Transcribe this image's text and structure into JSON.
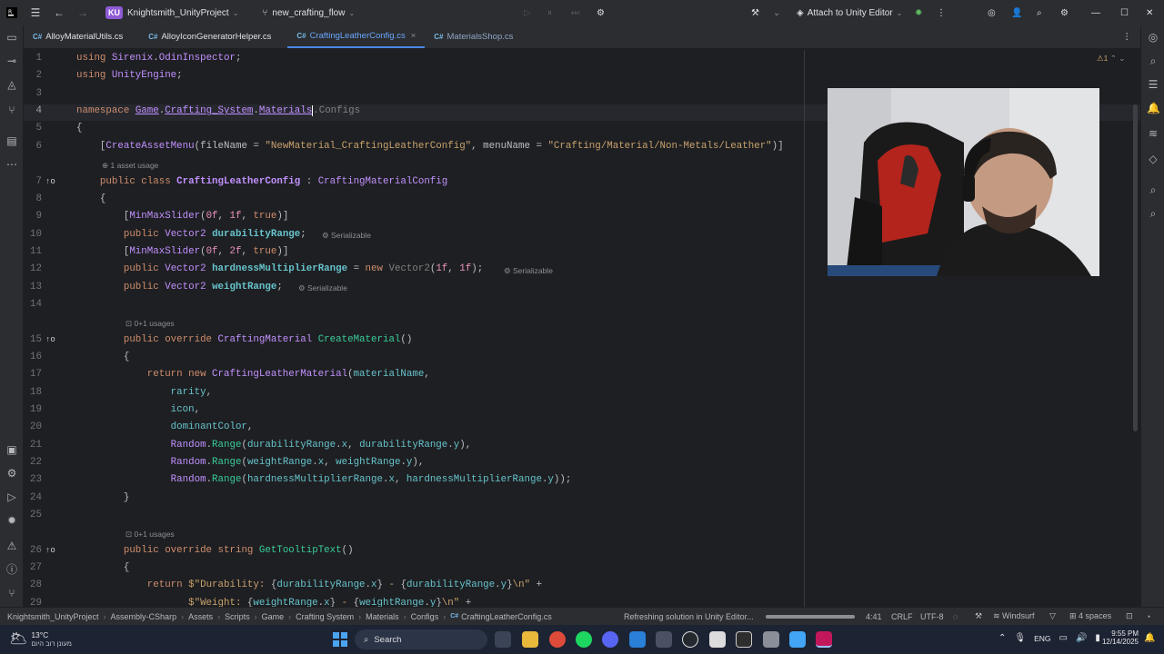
{
  "titlebar": {
    "project_badge": "KU",
    "project_name": "Knightsmith_UnityProject",
    "branch": "new_crafting_flow",
    "attach": "Attach to Unity Editor"
  },
  "tabs": [
    {
      "label": "AlloyMaterialUtils.cs"
    },
    {
      "label": "AlloyIconGeneratorHelper.cs"
    },
    {
      "label": "CraftingLeatherConfig.cs"
    },
    {
      "label": "MaterialsShop.cs"
    }
  ],
  "editor": {
    "inspection_count": "1",
    "hints": {
      "asset_usage": "1 asset usage",
      "usages_a": "0+1 usages",
      "usages_b": "0+1 usages",
      "serializable": "Serializable"
    },
    "line_numbers": [
      "1",
      "2",
      "3",
      "4",
      "5",
      "6",
      "7",
      "8",
      "9",
      "10",
      "11",
      "12",
      "13",
      "14",
      "15",
      "16",
      "17",
      "18",
      "19",
      "20",
      "21",
      "22",
      "23",
      "24",
      "25",
      "26",
      "27",
      "28",
      "29"
    ]
  },
  "statusbar": {
    "breadcrumb": [
      "Knightsmith_UnityProject",
      "Assembly-CSharp",
      "Assets",
      "Scripts",
      "Game",
      "Crafting System",
      "Materials",
      "Configs",
      "CraftingLeatherConfig.cs"
    ],
    "refresh_text": "Refreshing solution in Unity Editor...",
    "position": "4:41",
    "line_sep": "CRLF",
    "encoding": "UTF-8",
    "plugin": "Windsurf",
    "indent": "4 spaces"
  },
  "taskbar": {
    "temp": "13°C",
    "weather": "מעונן רוב היום",
    "search_placeholder": "Search",
    "lang": "ENG",
    "time": "9:55 PM",
    "date": "12/14/2025"
  },
  "colors": {
    "accent": "#4a88e8",
    "editor_bg": "#1e1f22",
    "panel_bg": "#2b2d30"
  }
}
